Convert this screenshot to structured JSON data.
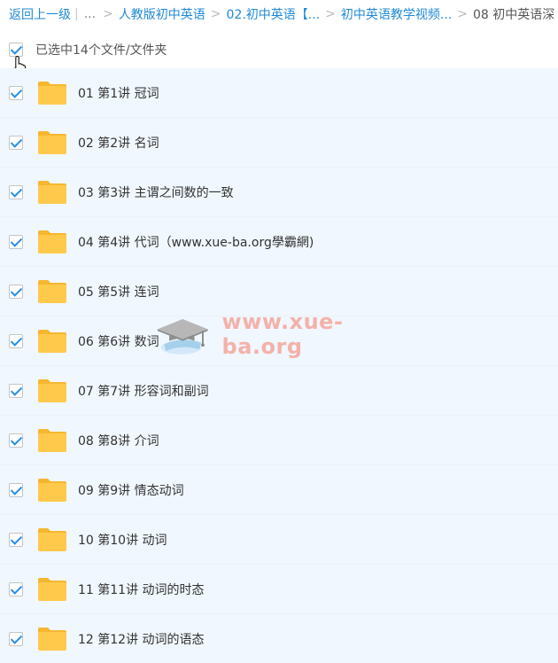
{
  "breadcrumb": {
    "back": "返回上一级",
    "pipe": "|",
    "ellipsis": "...",
    "sep": ">",
    "items": [
      "人教版初中英语",
      "02.初中英语【...",
      "初中英语教学视频..."
    ],
    "current": "08 初中英语深"
  },
  "selection": {
    "label": "已选中14个文件/文件夹",
    "checked": true
  },
  "files": [
    {
      "name": "01 第1讲 冠词"
    },
    {
      "name": "02 第2讲 名词"
    },
    {
      "name": "03 第3讲 主谓之间数的一致"
    },
    {
      "name": "04 第4讲 代词（www.xue-ba.org學霸網)"
    },
    {
      "name": "05 第5讲 连词"
    },
    {
      "name": "06 第6讲 数词"
    },
    {
      "name": "07 第7讲 形容词和副词"
    },
    {
      "name": "08 第8讲 介词"
    },
    {
      "name": "09 第9讲 情态动词"
    },
    {
      "name": "10 第10讲 动词"
    },
    {
      "name": "11 第11讲 动词的时态"
    },
    {
      "name": "12 第12讲 动词的语态"
    }
  ],
  "watermark": {
    "text": "www.xue-ba.org",
    "icon": "graduation-cap-icon"
  },
  "colors": {
    "link": "#1f8ad6",
    "check": "#2a8ee3",
    "row_bg": "#f0f7ff",
    "folder": "#ffc94c",
    "watermark": "#f4a79b"
  }
}
